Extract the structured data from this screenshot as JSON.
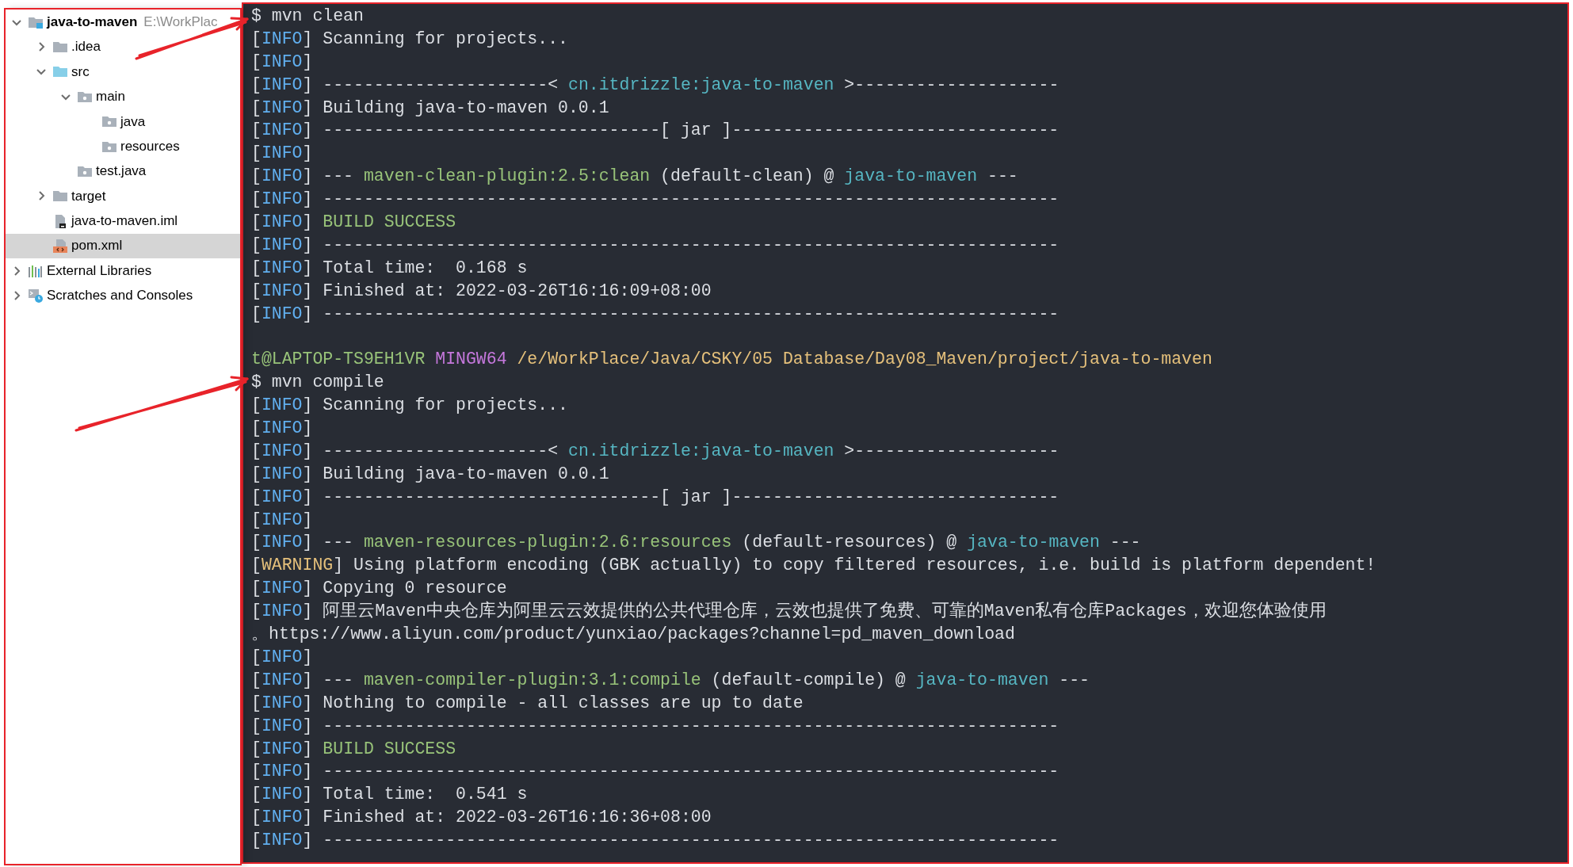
{
  "project_tree": [
    {
      "label": "java-to-maven",
      "hint": "E:\\WorkPlac",
      "kind": "module",
      "expanded": true,
      "selected": false,
      "children": [
        {
          "label": ".idea",
          "kind": "folder",
          "expanded": false,
          "selected": false
        },
        {
          "label": "src",
          "kind": "source-root",
          "expanded": true,
          "selected": false,
          "children": [
            {
              "label": "main",
              "kind": "package",
              "expanded": true,
              "selected": false,
              "children": [
                {
                  "label": "java",
                  "kind": "package",
                  "selected": false
                },
                {
                  "label": "resources",
                  "kind": "package",
                  "selected": false
                }
              ]
            },
            {
              "label": "test.java",
              "kind": "package",
              "selected": false
            }
          ]
        },
        {
          "label": "target",
          "kind": "folder",
          "expanded": false,
          "selected": false
        },
        {
          "label": "java-to-maven.iml",
          "kind": "iml-file",
          "selected": false
        },
        {
          "label": "pom.xml",
          "kind": "xml-file",
          "selected": true
        }
      ]
    },
    {
      "label": "External Libraries",
      "kind": "libraries",
      "expanded": false,
      "selected": false
    },
    {
      "label": "Scratches and Consoles",
      "kind": "scratches",
      "expanded": false,
      "selected": false
    }
  ],
  "terminal": {
    "lines": [
      {
        "kind": "text",
        "parts": [
          {
            "text": "$ mvn clean"
          }
        ]
      },
      {
        "kind": "text",
        "parts": [
          {
            "text": "["
          },
          {
            "text": "INFO",
            "color": "#61afef"
          },
          {
            "text": "] Scanning for projects..."
          }
        ]
      },
      {
        "kind": "text",
        "parts": [
          {
            "text": "["
          },
          {
            "text": "INFO",
            "color": "#61afef"
          },
          {
            "text": "]"
          }
        ]
      },
      {
        "kind": "text",
        "parts": [
          {
            "text": "["
          },
          {
            "text": "INFO",
            "color": "#61afef"
          },
          {
            "text": "] ----------------------< "
          },
          {
            "text": "cn.itdrizzle:java-to-maven",
            "color": "#56b6c2"
          },
          {
            "text": " >--------------------"
          }
        ]
      },
      {
        "kind": "text",
        "parts": [
          {
            "text": "["
          },
          {
            "text": "INFO",
            "color": "#61afef"
          },
          {
            "text": "] Building java-to-maven 0.0.1"
          }
        ]
      },
      {
        "kind": "text",
        "parts": [
          {
            "text": "["
          },
          {
            "text": "INFO",
            "color": "#61afef"
          },
          {
            "text": "] ---------------------------------[ jar ]--------------------------------"
          }
        ]
      },
      {
        "kind": "text",
        "parts": [
          {
            "text": "["
          },
          {
            "text": "INFO",
            "color": "#61afef"
          },
          {
            "text": "]"
          }
        ]
      },
      {
        "kind": "text",
        "parts": [
          {
            "text": "["
          },
          {
            "text": "INFO",
            "color": "#61afef"
          },
          {
            "text": "] --- "
          },
          {
            "text": "maven-clean-plugin:2.5:clean",
            "color": "#98c379"
          },
          {
            "text": " (default-clean) @ "
          },
          {
            "text": "java-to-maven",
            "color": "#56b6c2"
          },
          {
            "text": " ---"
          }
        ]
      },
      {
        "kind": "text",
        "parts": [
          {
            "text": "["
          },
          {
            "text": "INFO",
            "color": "#61afef"
          },
          {
            "text": "] ------------------------------------------------------------------------"
          }
        ]
      },
      {
        "kind": "text",
        "parts": [
          {
            "text": "["
          },
          {
            "text": "INFO",
            "color": "#61afef"
          },
          {
            "text": "] "
          },
          {
            "text": "BUILD SUCCESS",
            "color": "#98c379"
          }
        ]
      },
      {
        "kind": "text",
        "parts": [
          {
            "text": "["
          },
          {
            "text": "INFO",
            "color": "#61afef"
          },
          {
            "text": "] ------------------------------------------------------------------------"
          }
        ]
      },
      {
        "kind": "text",
        "parts": [
          {
            "text": "["
          },
          {
            "text": "INFO",
            "color": "#61afef"
          },
          {
            "text": "] Total time:  0.168 s"
          }
        ]
      },
      {
        "kind": "text",
        "parts": [
          {
            "text": "["
          },
          {
            "text": "INFO",
            "color": "#61afef"
          },
          {
            "text": "] Finished at: 2022-03-26T16:16:09+08:00"
          }
        ]
      },
      {
        "kind": "text",
        "parts": [
          {
            "text": "["
          },
          {
            "text": "INFO",
            "color": "#61afef"
          },
          {
            "text": "] ------------------------------------------------------------------------"
          }
        ]
      },
      {
        "kind": "blank"
      },
      {
        "kind": "text",
        "parts": [
          {
            "text": "t@LAPTOP-TS9EH1VR",
            "color": "#98c379"
          },
          {
            "text": " MINGW64",
            "color": "#c678dd"
          },
          {
            "text": " /e/WorkPlace/Java/CSKY/05 Database/Day08_Maven/project/java-to-maven",
            "color": "#e5c07b"
          }
        ]
      },
      {
        "kind": "text",
        "parts": [
          {
            "text": "$ mvn compile"
          }
        ]
      },
      {
        "kind": "text",
        "parts": [
          {
            "text": "["
          },
          {
            "text": "INFO",
            "color": "#61afef"
          },
          {
            "text": "] Scanning for projects..."
          }
        ]
      },
      {
        "kind": "text",
        "parts": [
          {
            "text": "["
          },
          {
            "text": "INFO",
            "color": "#61afef"
          },
          {
            "text": "]"
          }
        ]
      },
      {
        "kind": "text",
        "parts": [
          {
            "text": "["
          },
          {
            "text": "INFO",
            "color": "#61afef"
          },
          {
            "text": "] ----------------------< "
          },
          {
            "text": "cn.itdrizzle:java-to-maven",
            "color": "#56b6c2"
          },
          {
            "text": " >--------------------"
          }
        ]
      },
      {
        "kind": "text",
        "parts": [
          {
            "text": "["
          },
          {
            "text": "INFO",
            "color": "#61afef"
          },
          {
            "text": "] Building java-to-maven 0.0.1"
          }
        ]
      },
      {
        "kind": "text",
        "parts": [
          {
            "text": "["
          },
          {
            "text": "INFO",
            "color": "#61afef"
          },
          {
            "text": "] ---------------------------------[ jar ]--------------------------------"
          }
        ]
      },
      {
        "kind": "text",
        "parts": [
          {
            "text": "["
          },
          {
            "text": "INFO",
            "color": "#61afef"
          },
          {
            "text": "]"
          }
        ]
      },
      {
        "kind": "text",
        "parts": [
          {
            "text": "["
          },
          {
            "text": "INFO",
            "color": "#61afef"
          },
          {
            "text": "] --- "
          },
          {
            "text": "maven-resources-plugin:2.6:resources",
            "color": "#98c379"
          },
          {
            "text": " (default-resources) @ "
          },
          {
            "text": "java-to-maven",
            "color": "#56b6c2"
          },
          {
            "text": " ---"
          }
        ]
      },
      {
        "kind": "text",
        "parts": [
          {
            "text": "["
          },
          {
            "text": "WARNING",
            "color": "#e5c07b"
          },
          {
            "text": "] Using platform encoding (GBK actually) to copy filtered resources, i.e. build is platform dependent!"
          }
        ]
      },
      {
        "kind": "text",
        "parts": [
          {
            "text": "["
          },
          {
            "text": "INFO",
            "color": "#61afef"
          },
          {
            "text": "] Copying 0 resource"
          }
        ]
      },
      {
        "kind": "text",
        "parts": [
          {
            "text": "["
          },
          {
            "text": "INFO",
            "color": "#61afef"
          },
          {
            "text": "] 阿里云Maven中央仓库为阿里云云效提供的公共代理仓库，云效也提供了免费、可靠的Maven私有仓库Packages，欢迎您体验使用"
          }
        ]
      },
      {
        "kind": "text",
        "parts": [
          {
            "text": "。https://www.aliyun.com/product/yunxiao/packages?channel=pd_maven_download"
          }
        ]
      },
      {
        "kind": "text",
        "parts": [
          {
            "text": "["
          },
          {
            "text": "INFO",
            "color": "#61afef"
          },
          {
            "text": "]"
          }
        ]
      },
      {
        "kind": "text",
        "parts": [
          {
            "text": "["
          },
          {
            "text": "INFO",
            "color": "#61afef"
          },
          {
            "text": "] --- "
          },
          {
            "text": "maven-compiler-plugin:3.1:compile",
            "color": "#98c379"
          },
          {
            "text": " (default-compile) @ "
          },
          {
            "text": "java-to-maven",
            "color": "#56b6c2"
          },
          {
            "text": " ---"
          }
        ]
      },
      {
        "kind": "text",
        "parts": [
          {
            "text": "["
          },
          {
            "text": "INFO",
            "color": "#61afef"
          },
          {
            "text": "] Nothing to compile - all classes are up to date"
          }
        ]
      },
      {
        "kind": "text",
        "parts": [
          {
            "text": "["
          },
          {
            "text": "INFO",
            "color": "#61afef"
          },
          {
            "text": "] ------------------------------------------------------------------------"
          }
        ]
      },
      {
        "kind": "text",
        "parts": [
          {
            "text": "["
          },
          {
            "text": "INFO",
            "color": "#61afef"
          },
          {
            "text": "] "
          },
          {
            "text": "BUILD SUCCESS",
            "color": "#98c379"
          }
        ]
      },
      {
        "kind": "text",
        "parts": [
          {
            "text": "["
          },
          {
            "text": "INFO",
            "color": "#61afef"
          },
          {
            "text": "] ------------------------------------------------------------------------"
          }
        ]
      },
      {
        "kind": "text",
        "parts": [
          {
            "text": "["
          },
          {
            "text": "INFO",
            "color": "#61afef"
          },
          {
            "text": "] Total time:  0.541 s"
          }
        ]
      },
      {
        "kind": "text",
        "parts": [
          {
            "text": "["
          },
          {
            "text": "INFO",
            "color": "#61afef"
          },
          {
            "text": "] Finished at: 2022-03-26T16:16:36+08:00"
          }
        ]
      },
      {
        "kind": "text",
        "parts": [
          {
            "text": "["
          },
          {
            "text": "INFO",
            "color": "#61afef"
          },
          {
            "text": "] ------------------------------------------------------------------------"
          }
        ]
      }
    ]
  }
}
